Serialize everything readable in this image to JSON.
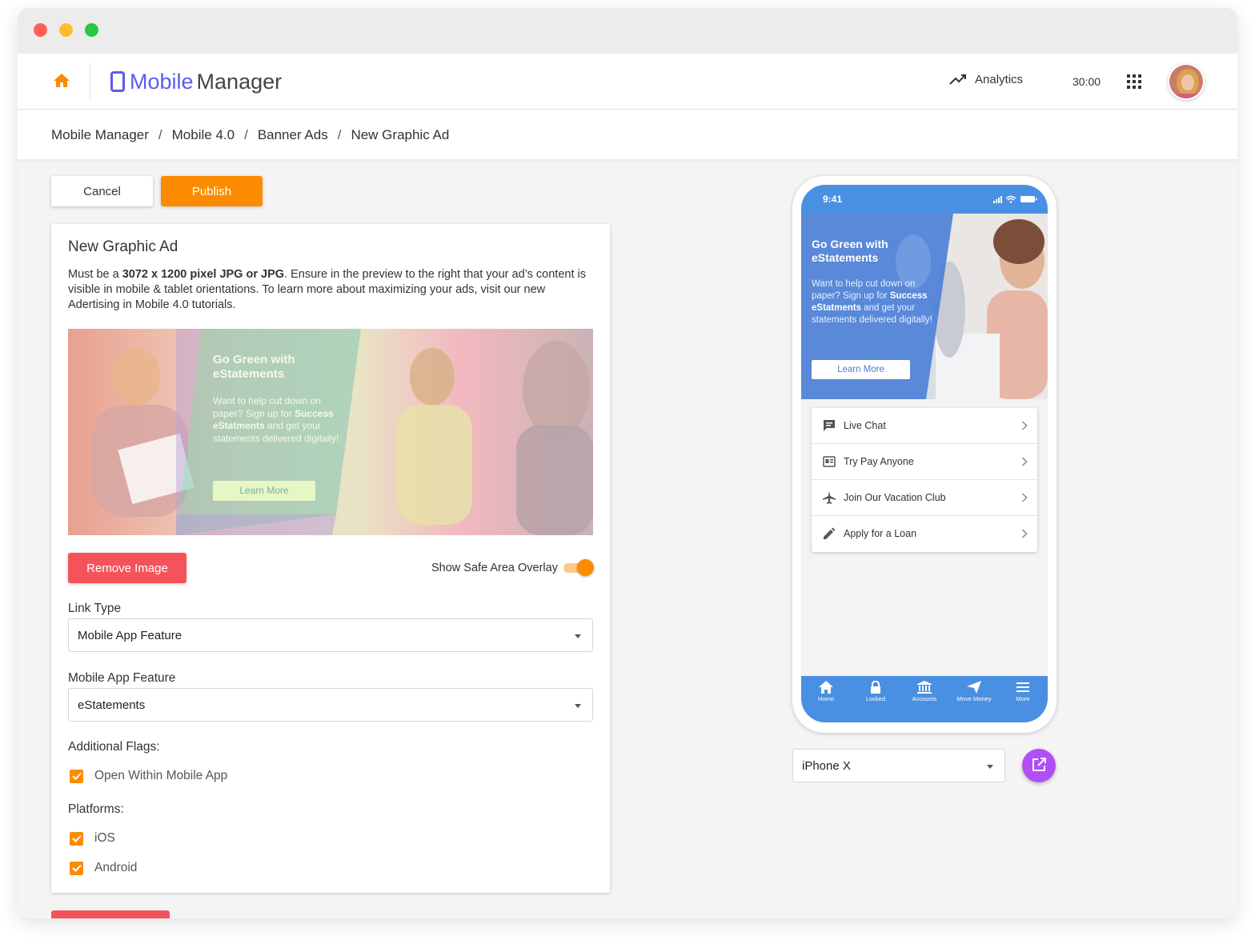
{
  "window": {
    "controls": [
      "close",
      "minimize",
      "maximize"
    ],
    "colors": {
      "close": "#ff5f57",
      "minimize": "#febc2e",
      "maximize": "#28c840"
    }
  },
  "header": {
    "home_icon": "home-icon",
    "logo": {
      "icon": "mobile-phone-icon",
      "part1": "Mobile",
      "part2": "Manager"
    },
    "analytics_label": "Analytics",
    "timer": "30:00",
    "apps_icon": "apps-grid-icon"
  },
  "breadcrumb": [
    "Mobile Manager",
    "Mobile 4.0",
    "Banner Ads",
    "New Graphic Ad"
  ],
  "breadcrumb_sep": "/",
  "actions": {
    "cancel": "Cancel",
    "publish": "Publish"
  },
  "form": {
    "title": "New Graphic Ad",
    "desc_prefix": "Must be a ",
    "desc_bold": "3072 x 1200 pixel JPG or JPG",
    "desc_suffix": ". Ensure in the preview to the right that your ad’s content is visible in mobile & tablet orientations. To learn more about maximizing your ads, visit our new Adertising in Mobile 4.0 tutorials.",
    "banner": {
      "headline": "Go Green with eStatements",
      "body_1": "Want to help cut down on paper? Sign up for",
      "body_bold": "Success eStatments",
      "body_2": "and get your statements delivered digitally!",
      "cta": "Learn More"
    },
    "remove_image": "Remove Image",
    "overlay_label": "Show Safe Area Overlay",
    "overlay_on": true,
    "link_type_label": "Link Type",
    "link_type_value": "Mobile App Feature",
    "feature_label": "Mobile App Feature",
    "feature_value": "eStatements",
    "flags_label": "Additional Flags:",
    "flags": [
      {
        "label": "Open Within Mobile App",
        "checked": true
      }
    ],
    "platforms_label": "Platforms:",
    "platforms": [
      {
        "label": "iOS",
        "checked": true
      },
      {
        "label": "Android",
        "checked": true
      }
    ]
  },
  "phone": {
    "status_time": "9:41",
    "banner": {
      "headline": "Go Green with eStatements",
      "body_1": "Want to help cut down on paper? Sign up for",
      "body_bold": "Success eStatments",
      "body_2": "and get your statements delivered digitally!",
      "cta": "Learn More"
    },
    "menu": [
      {
        "label": "Live Chat",
        "icon": "chat-icon"
      },
      {
        "label": "Try Pay Anyone",
        "icon": "pay-anyone-icon"
      },
      {
        "label": "Join Our Vacation Club",
        "icon": "airplane-icon"
      },
      {
        "label": "Apply for a Loan",
        "icon": "pencil-icon"
      }
    ],
    "tabs": [
      {
        "label": "Home",
        "icon": "home-icon"
      },
      {
        "label": "Locked",
        "icon": "lock-icon"
      },
      {
        "label": "Accounts",
        "icon": "bank-icon"
      },
      {
        "label": "Move Money",
        "icon": "send-icon"
      },
      {
        "label": "More",
        "icon": "menu-icon"
      }
    ]
  },
  "device_select": {
    "value": "iPhone X",
    "open_icon": "open-external-icon"
  },
  "colors": {
    "accent": "#fb8c00",
    "danger": "#f5535b",
    "brand": "#5b5bf0",
    "phone_blue": "#4a90e2",
    "purple": "#b04ff5"
  }
}
